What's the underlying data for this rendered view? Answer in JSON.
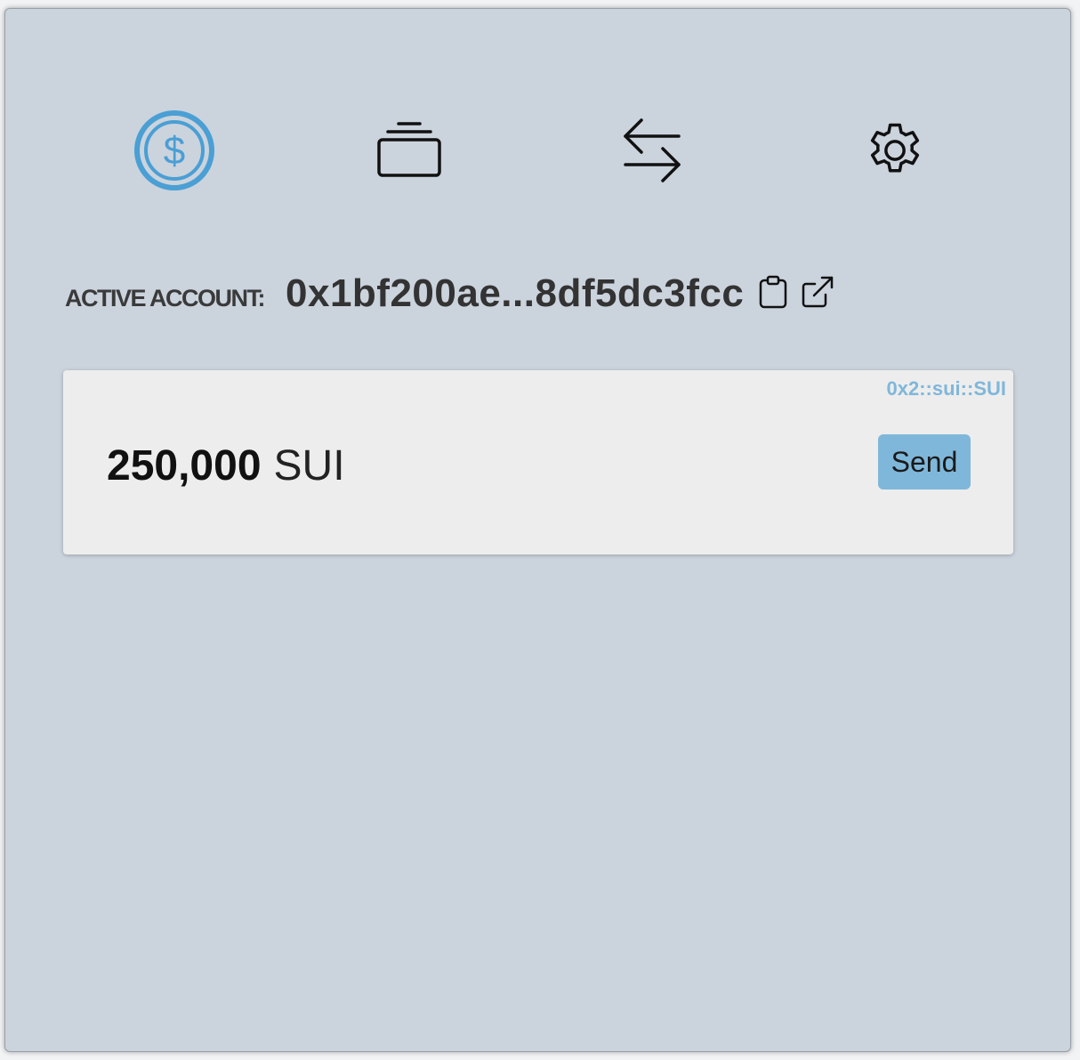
{
  "nav": {
    "items": [
      {
        "icon": "dollar-coin-icon",
        "active": true
      },
      {
        "icon": "stacked-cards-icon",
        "active": false
      },
      {
        "icon": "swap-arrows-icon",
        "active": false
      },
      {
        "icon": "gear-icon",
        "active": false
      }
    ]
  },
  "account": {
    "label": "ACTIVE ACCOUNT:",
    "address": "0x1bf200ae...8df5dc3fcc",
    "copy_icon": "clipboard-icon",
    "explorer_icon": "external-link-icon"
  },
  "coins": [
    {
      "type": "0x2::sui::SUI",
      "amount": "250,000",
      "symbol": "SUI",
      "send_label": "Send"
    }
  ],
  "colors": {
    "background": "#cbd3dd",
    "accent": "#4a9fd4",
    "card": "#ededed",
    "send_button": "#7fb7da",
    "coin_type_text": "#7fb7da"
  }
}
